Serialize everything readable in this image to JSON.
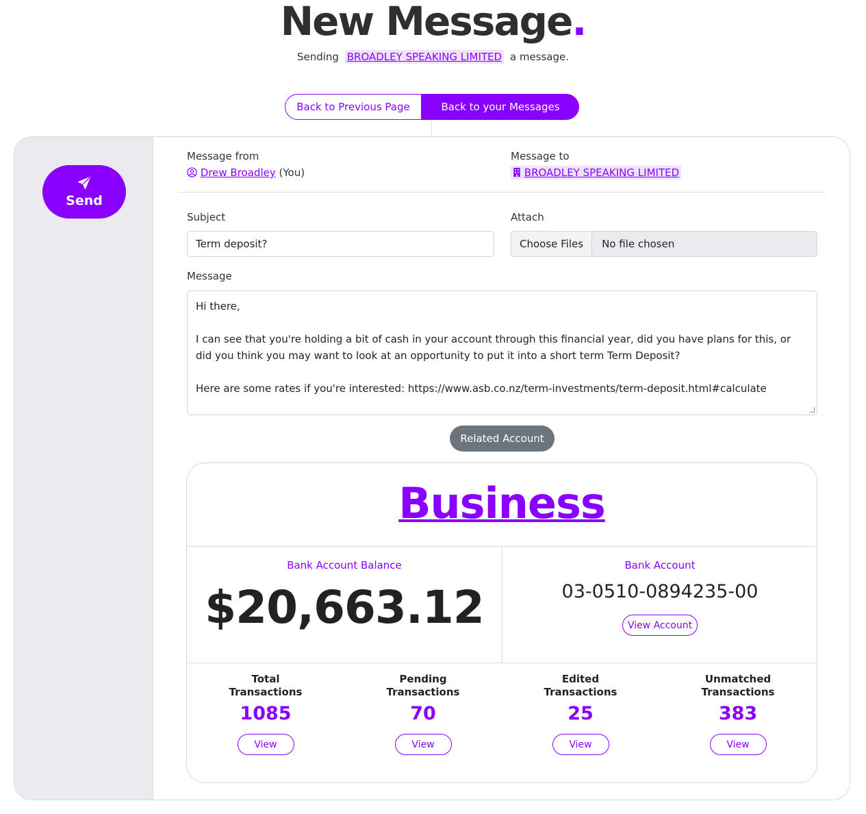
{
  "header": {
    "title": "New Message",
    "title_dot": ".",
    "subtitle_prefix": "Sending",
    "subtitle_company": "BROADLEY SPEAKING LIMITED",
    "subtitle_suffix": "a message."
  },
  "nav": {
    "back_previous": "Back to Previous Page",
    "back_messages": "Back to your Messages"
  },
  "sidebar": {
    "send_label": "Send"
  },
  "form": {
    "from_label": "Message from",
    "from_name": "Drew Broadley",
    "from_suffix": "(You)",
    "to_label": "Message to",
    "to_name": "BROADLEY SPEAKING LIMITED",
    "subject_label": "Subject",
    "subject_value": "Term deposit?",
    "attach_label": "Attach",
    "choose_files": "Choose Files",
    "no_file": "No file chosen",
    "message_label": "Message",
    "message_value": "Hi there,\n\nI can see that you're holding a bit of cash in your account through this financial year, did you have plans for this, or did you think you may want to look at an opportunity to put it into a short term Term Deposit?\n\nHere are some rates if you're interested: https://www.asb.co.nz/term-investments/term-deposit.html#calculate"
  },
  "related": {
    "button_label": "Related Account",
    "account_name": "Business",
    "balance_label": "Bank Account Balance",
    "balance_value": "$20,663.12",
    "bank_account_label": "Bank Account",
    "bank_account_number": "03-0510-0894235-00",
    "view_account": "View Account",
    "stats": [
      {
        "label_line1": "Total",
        "label_line2": "Transactions",
        "value": "1085",
        "button": "View"
      },
      {
        "label_line1": "Pending",
        "label_line2": "Transactions",
        "value": "70",
        "button": "View"
      },
      {
        "label_line1": "Edited",
        "label_line2": "Transactions",
        "value": "25",
        "button": "View"
      },
      {
        "label_line1": "Unmatched",
        "label_line2": "Transactions",
        "value": "383",
        "button": "View"
      }
    ]
  },
  "colors": {
    "accent": "#8a00ff",
    "secondary_button": "#6c757d",
    "sidebar_bg": "#ebebef"
  }
}
